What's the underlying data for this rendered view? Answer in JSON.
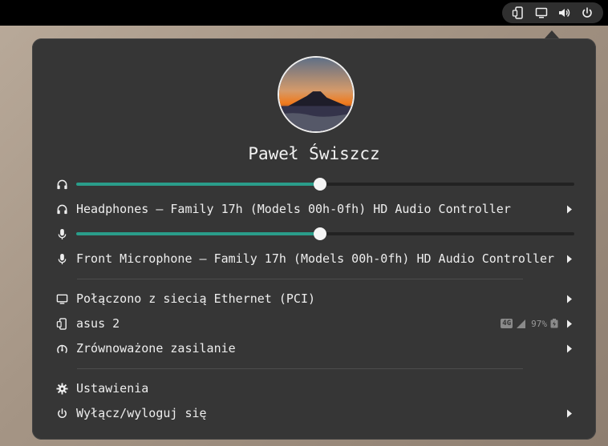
{
  "top_bar": {
    "tray_icons": [
      "phone-icon",
      "display-icon",
      "speaker-icon",
      "power-icon"
    ]
  },
  "user": {
    "name": "Paweł Świszcz"
  },
  "audio": {
    "output_volume": 0.49,
    "output_device": "Headphones – Family 17h (Models 00h-0fh) HD Audio Controller",
    "input_volume": 0.49,
    "input_device": "Front Microphone – Family 17h (Models 00h-0fh) HD Audio Controller"
  },
  "network": {
    "label": "Połączono z siecią Ethernet (PCI)"
  },
  "device": {
    "label": "asus 2",
    "network_type": "4G",
    "battery": "97%"
  },
  "power": {
    "label": "Zrównoważone zasilanie"
  },
  "settings": {
    "label": "Ustawienia"
  },
  "shutdown": {
    "label": "Wyłącz/wyloguj się"
  },
  "colors": {
    "accent": "#2a9d8a",
    "menu_bg": "#363636"
  }
}
